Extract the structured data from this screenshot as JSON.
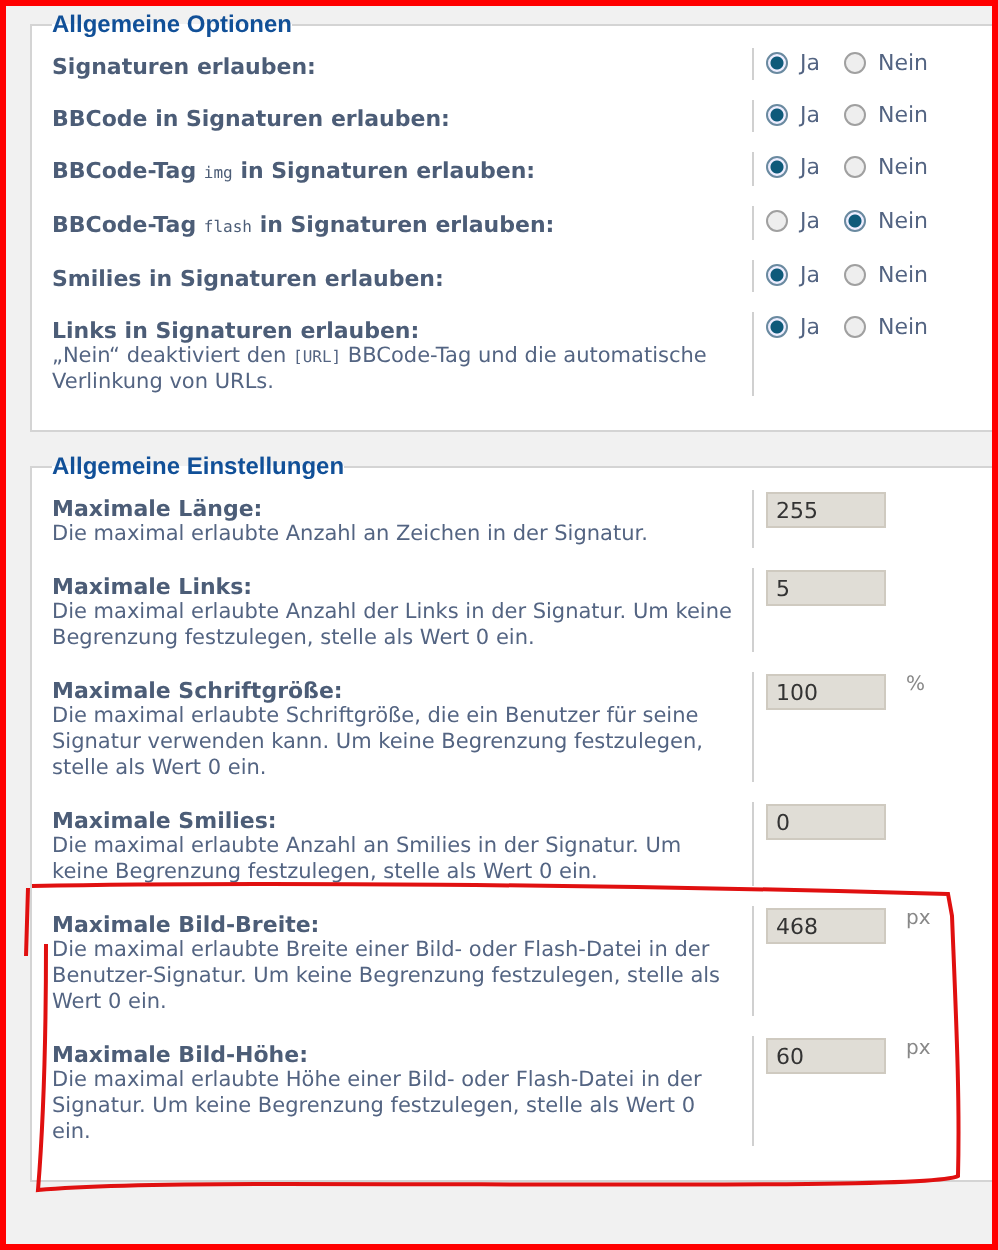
{
  "sections": [
    {
      "legend": "Allgemeine Optionen",
      "kind": "radios",
      "rows": [
        {
          "label": [
            {
              "text": "Signaturen erlauben:",
              "kind": "plain"
            }
          ],
          "options": [
            {
              "label": "Ja",
              "selected": true
            },
            {
              "label": "Nein",
              "selected": false
            }
          ]
        },
        {
          "label": [
            {
              "text": "BBCode in Signaturen erlauben:",
              "kind": "plain"
            }
          ],
          "options": [
            {
              "label": "Ja",
              "selected": true
            },
            {
              "label": "Nein",
              "selected": false
            }
          ]
        },
        {
          "label": [
            {
              "text": "BBCode-Tag ",
              "kind": "plain"
            },
            {
              "text": "img",
              "kind": "code"
            },
            {
              "text": " in Signaturen erlauben:",
              "kind": "plain"
            }
          ],
          "options": [
            {
              "label": "Ja",
              "selected": true
            },
            {
              "label": "Nein",
              "selected": false
            }
          ]
        },
        {
          "label": [
            {
              "text": "BBCode-Tag ",
              "kind": "plain"
            },
            {
              "text": "flash",
              "kind": "code"
            },
            {
              "text": " in Signaturen erlauben:",
              "kind": "plain"
            }
          ],
          "options": [
            {
              "label": "Ja",
              "selected": false
            },
            {
              "label": "Nein",
              "selected": true
            }
          ]
        },
        {
          "label": [
            {
              "text": "Smilies in Signaturen erlauben:",
              "kind": "plain"
            }
          ],
          "options": [
            {
              "label": "Ja",
              "selected": true
            },
            {
              "label": "Nein",
              "selected": false
            }
          ]
        },
        {
          "label": [
            {
              "text": "Links in Signaturen erlauben:",
              "kind": "plain"
            }
          ],
          "description": [
            {
              "text": "„Nein“ deaktiviert den ",
              "kind": "plain"
            },
            {
              "text": "[URL]",
              "kind": "code"
            },
            {
              "text": " BBCode-Tag und die automatische Verlinkung von URLs.",
              "kind": "plain"
            }
          ],
          "options": [
            {
              "label": "Ja",
              "selected": true
            },
            {
              "label": "Nein",
              "selected": false
            }
          ]
        }
      ]
    },
    {
      "legend": "Allgemeine Einstellungen",
      "kind": "inputs",
      "rows": [
        {
          "label": [
            {
              "text": "Maximale Länge:",
              "kind": "plain"
            }
          ],
          "description": [
            {
              "text": "Die maximal erlaubte Anzahl an Zeichen in der Signatur.",
              "kind": "plain"
            }
          ],
          "value": "255"
        },
        {
          "label": [
            {
              "text": "Maximale Links:",
              "kind": "plain"
            }
          ],
          "description": [
            {
              "text": "Die maximal erlaubte Anzahl der Links in der Signatur. Um keine Begrenzung festzulegen, stelle als Wert 0 ein.",
              "kind": "plain"
            }
          ],
          "value": "5"
        },
        {
          "label": [
            {
              "text": "Maximale Schriftgröße:",
              "kind": "plain"
            }
          ],
          "description": [
            {
              "text": "Die maximal erlaubte Schriftgröße, die ein Benutzer für seine Signatur verwenden kann. Um keine Begrenzung festzulegen, stelle als Wert 0 ein.",
              "kind": "plain"
            }
          ],
          "value": "100",
          "unit": "%"
        },
        {
          "label": [
            {
              "text": "Maximale Smilies:",
              "kind": "plain"
            }
          ],
          "description": [
            {
              "text": "Die maximal erlaubte Anzahl an Smilies in der Signatur. Um keine Begrenzung festzulegen, stelle als Wert 0 ein.",
              "kind": "plain"
            }
          ],
          "value": "0"
        },
        {
          "label": [
            {
              "text": "Maximale Bild-Breite:",
              "kind": "plain"
            }
          ],
          "description": [
            {
              "text": "Die maximal erlaubte Breite einer Bild- oder Flash-Datei in der Benutzer-Signatur. Um keine Begrenzung festzulegen, stelle als Wert 0 ein.",
              "kind": "plain"
            }
          ],
          "value": "468",
          "unit": "px"
        },
        {
          "label": [
            {
              "text": "Maximale Bild-Höhe:",
              "kind": "plain"
            }
          ],
          "description": [
            {
              "text": "Die maximal erlaubte Höhe einer Bild- oder Flash-Datei in der Signatur. Um keine Begrenzung festzulegen, stelle als Wert 0 ein.",
              "kind": "plain"
            }
          ],
          "value": "60",
          "unit": "px"
        }
      ]
    }
  ]
}
